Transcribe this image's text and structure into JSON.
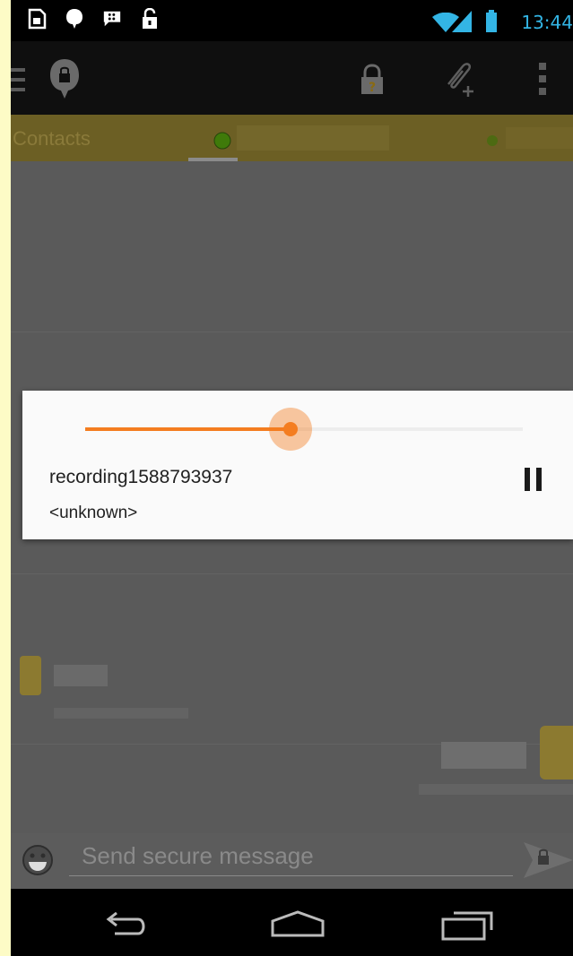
{
  "status_bar": {
    "time": "13:44",
    "left_icons": [
      "sim-icon",
      "bubble-lock-icon",
      "bbm-icon",
      "unlock-icon"
    ],
    "right_icons": [
      "wifi-icon",
      "signal-icon",
      "battery-icon"
    ]
  },
  "action_bar": {
    "icons": [
      "menu-icon",
      "app-logo-icon",
      "lock-question-icon",
      "attach-icon",
      "overflow-icon"
    ]
  },
  "tabs": {
    "contacts_label": "Contacts"
  },
  "player_dialog": {
    "title": "recording1588793937",
    "subtitle": "<unknown>",
    "progress": 0.47,
    "accent_color": "#f47d20",
    "control_icon": "pause-icon"
  },
  "composer": {
    "placeholder": "Send secure message",
    "emoji_icon": "emoji-icon",
    "send_icon": "send-lock-icon"
  },
  "nav_bar": {
    "icons": [
      "back-icon",
      "home-icon",
      "recents-icon"
    ]
  }
}
